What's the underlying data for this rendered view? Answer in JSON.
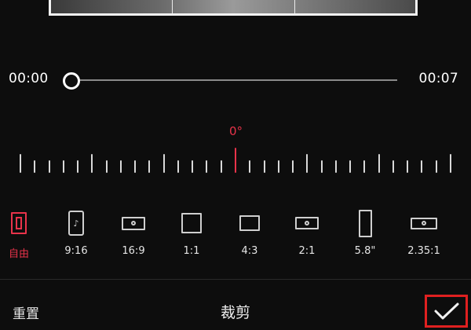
{
  "scrubber": {
    "start_time": "00:00",
    "end_time": "00:07",
    "position": 0
  },
  "rotation": {
    "angle_label": "0°",
    "angle": 0
  },
  "ratios": [
    {
      "label": "自由",
      "icon": "free-crop-icon",
      "active": true
    },
    {
      "label": "9:16",
      "icon": "tiktok-portrait-icon",
      "active": false
    },
    {
      "label": "16:9",
      "icon": "widescreen-icon",
      "active": false
    },
    {
      "label": "1:1",
      "icon": "square-icon",
      "active": false
    },
    {
      "label": "4:3",
      "icon": "landscape-4-3-icon",
      "active": false
    },
    {
      "label": "2:1",
      "icon": "landscape-2-1-icon",
      "active": false
    },
    {
      "label": "5.8\"",
      "icon": "phone-portrait-icon",
      "active": false
    },
    {
      "label": "2.35:1",
      "icon": "cinema-icon",
      "active": false
    }
  ],
  "bottom_bar": {
    "reset_label": "重置",
    "title": "裁剪",
    "confirm_icon": "checkmark-icon"
  },
  "colors": {
    "accent": "#e8334a",
    "highlight_box": "#e02020",
    "background": "#0d0d0d"
  }
}
